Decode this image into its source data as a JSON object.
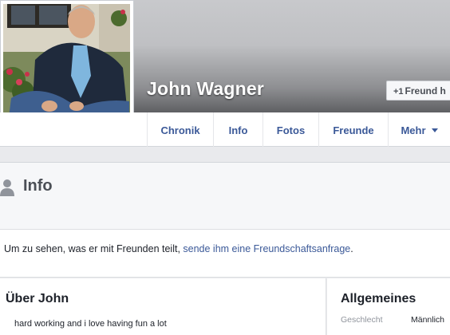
{
  "profile": {
    "name": "John Wagner",
    "friend_button": "Freund h",
    "friend_button_icon": "add-friend-icon"
  },
  "nav": {
    "tabs": [
      {
        "label": "Chronik"
      },
      {
        "label": "Info"
      },
      {
        "label": "Fotos"
      },
      {
        "label": "Freunde"
      },
      {
        "label": "Mehr"
      }
    ]
  },
  "info": {
    "title": "Info",
    "notice_prefix": "Um zu sehen, was er mit Freunden teilt, ",
    "notice_link": "sende ihm eine Freundschaftsanfrage",
    "notice_suffix": "."
  },
  "about": {
    "title": "Über John",
    "text": "hard working and i love having fun a lot"
  },
  "general": {
    "title": "Allgemeines",
    "rows": [
      {
        "label": "Geschlecht",
        "value": "Männlich"
      }
    ]
  },
  "colors": {
    "link": "#3b5998",
    "background": "#e9eaed"
  }
}
